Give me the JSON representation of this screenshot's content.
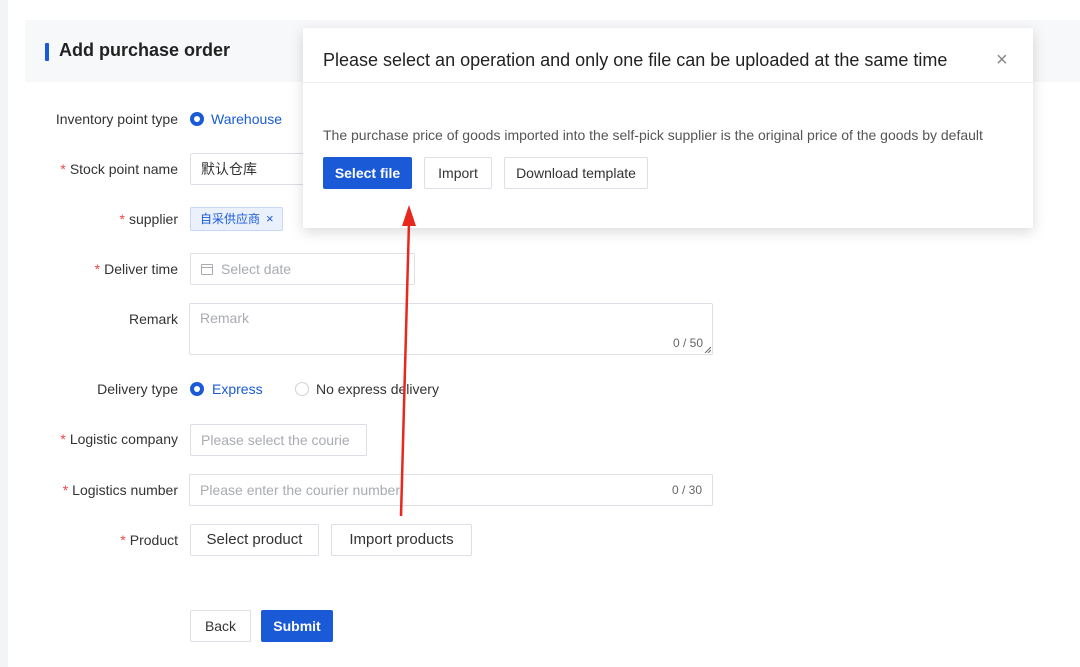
{
  "page": {
    "title": "Add purchase order"
  },
  "form": {
    "inventory_point_type": {
      "label": "Inventory point type",
      "option": "Warehouse"
    },
    "stock_point_name": {
      "label": "Stock point name",
      "value": "默认仓库"
    },
    "supplier": {
      "label": "supplier",
      "tag": "自采供应商",
      "remove_glyph": "×"
    },
    "deliver_time": {
      "label": "Deliver time",
      "placeholder": "Select date"
    },
    "remark": {
      "label": "Remark",
      "placeholder": "Remark",
      "counter": "0 / 50"
    },
    "delivery_type": {
      "label": "Delivery type",
      "options": [
        "Express",
        "No express delivery"
      ],
      "selected": "Express"
    },
    "logistic_company": {
      "label": "Logistic company",
      "placeholder": "Please select the courie"
    },
    "logistics_number": {
      "label": "Logistics number",
      "placeholder": "Please enter the courier number",
      "counter": "0 / 30"
    },
    "product": {
      "label": "Product",
      "select_button": "Select product",
      "import_button": "Import products"
    },
    "required_mark": "*"
  },
  "footer": {
    "back": "Back",
    "submit": "Submit"
  },
  "dialog": {
    "title": "Please select an operation and only one file can be uploaded at the same time",
    "close_glyph": "×",
    "note": "The purchase price of goods imported into the self-pick supplier is the original price of the goods by default",
    "buttons": {
      "select_file": "Select file",
      "import": "Import",
      "download_template": "Download template"
    }
  },
  "colors": {
    "primary": "#1a5ad7",
    "required": "#f04343",
    "annotation_arrow": "#e8281e"
  },
  "icons": {
    "calendar": "calendar-icon",
    "close": "close-icon",
    "resize": "resize-handle-icon"
  }
}
